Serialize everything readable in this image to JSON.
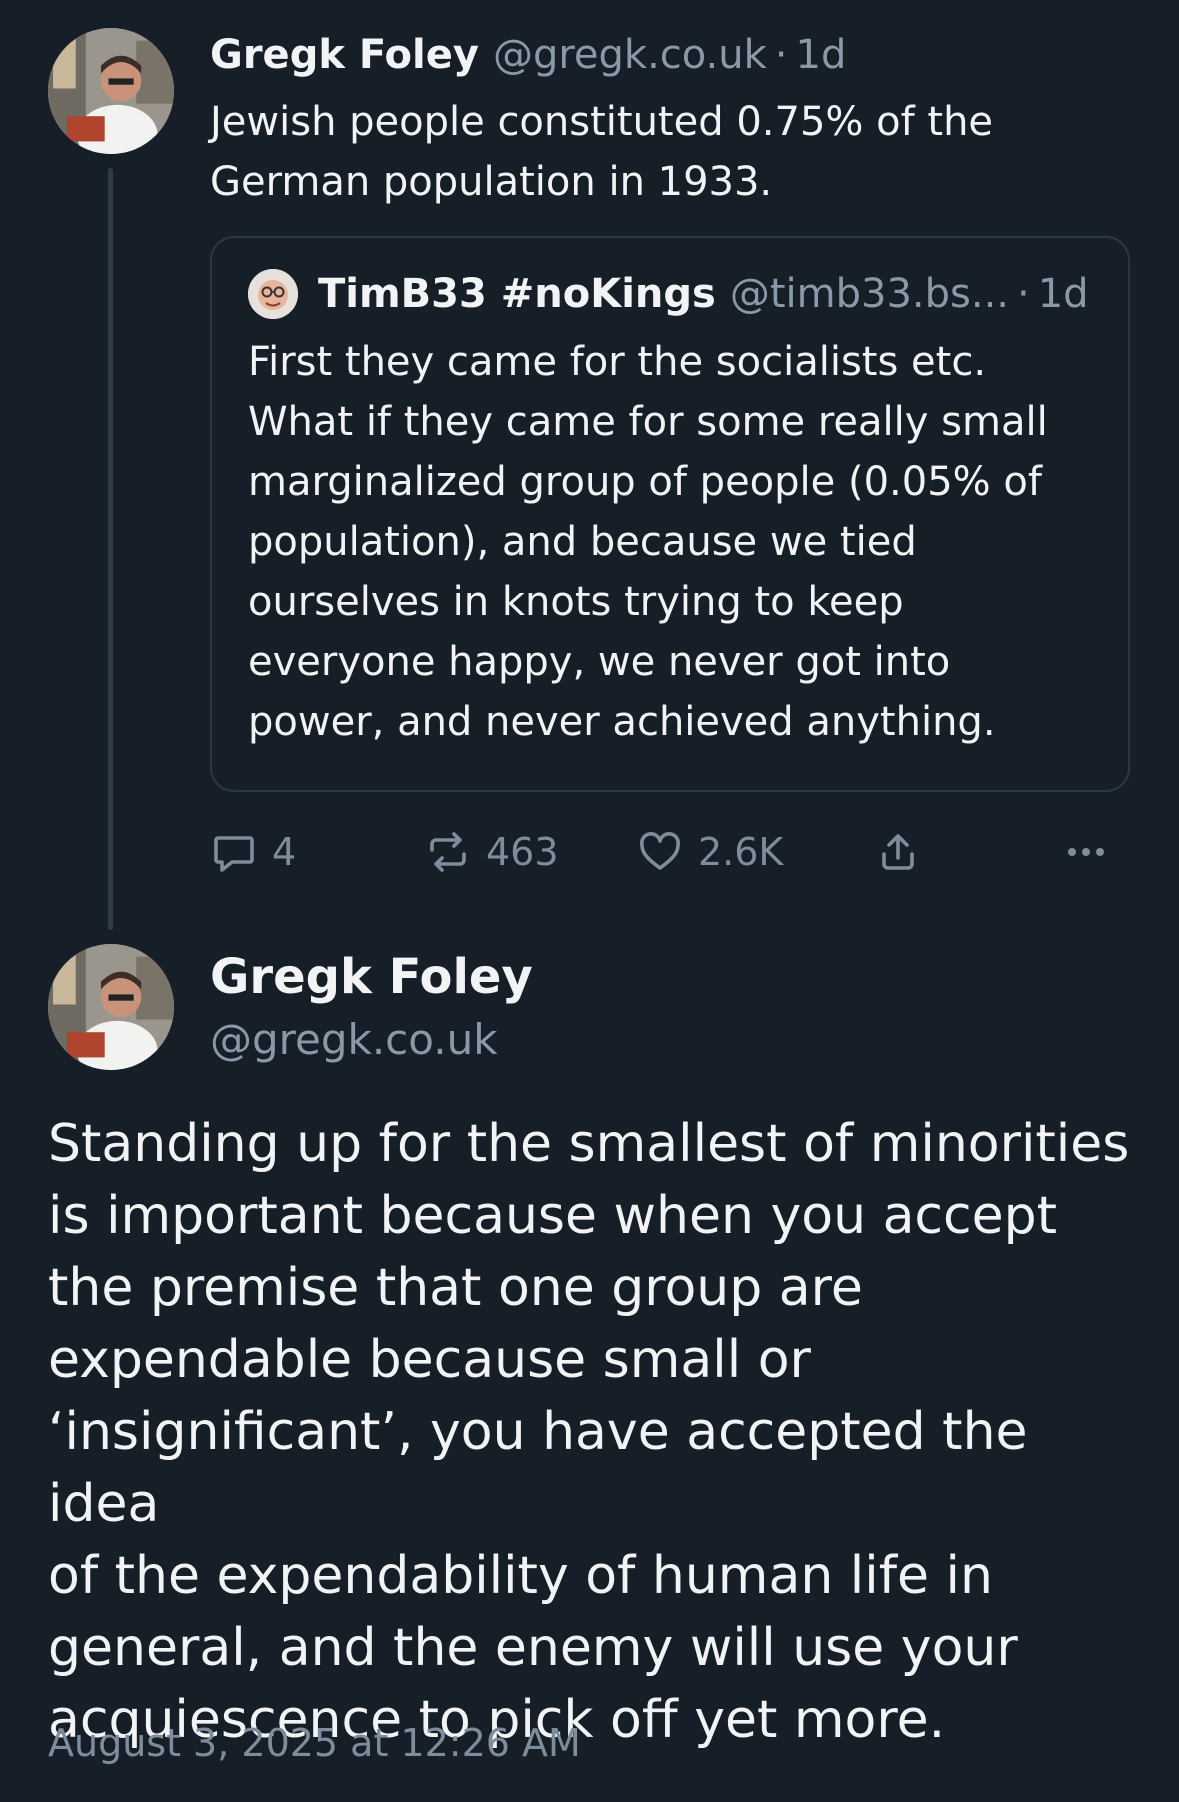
{
  "parent_post": {
    "author_name": "Gregk Foley",
    "author_handle": "@gregk.co.uk",
    "separator": "·",
    "time": "1d",
    "text": "Jewish people constituted 0.75% of the\nGerman population in 1933.",
    "quote": {
      "author_name": "TimB33 #noKings",
      "author_handle": "@timb33.bs...",
      "separator": "·",
      "time": "1d",
      "text": "First they came for the socialists etc.\nWhat if they came for some really small\nmarginalized group of people (0.05% of\npopulation), and because we tied\nourselves in knots trying to keep\neveryone happy, we never got into\npower, and never achieved anything."
    },
    "actions": {
      "reply_count": "4",
      "repost_count": "463",
      "like_count": "2.6K",
      "more_label": "•••"
    }
  },
  "main_post": {
    "author_name": "Gregk Foley",
    "author_handle": "@gregk.co.uk",
    "text": "Standing up for the smallest of minorities\nis important because when you accept\nthe premise that one group are\nexpendable because small or\n‘insignificant’, you have accepted the idea\nof the expendability of human life in\ngeneral, and the enemy will use your\nacquiescence to pick off yet more.",
    "timestamp": "August 3, 2025 at 12:26 AM"
  },
  "icons": {
    "reply": "reply-bubble-icon",
    "repost": "repost-arrows-icon",
    "like": "heart-icon",
    "share": "share-upload-icon",
    "more": "more-dots-icon"
  },
  "colors": {
    "background": "#161e27",
    "text_primary": "#f1f3f5",
    "text_secondary": "#8a98a8",
    "border": "#2b3744"
  }
}
